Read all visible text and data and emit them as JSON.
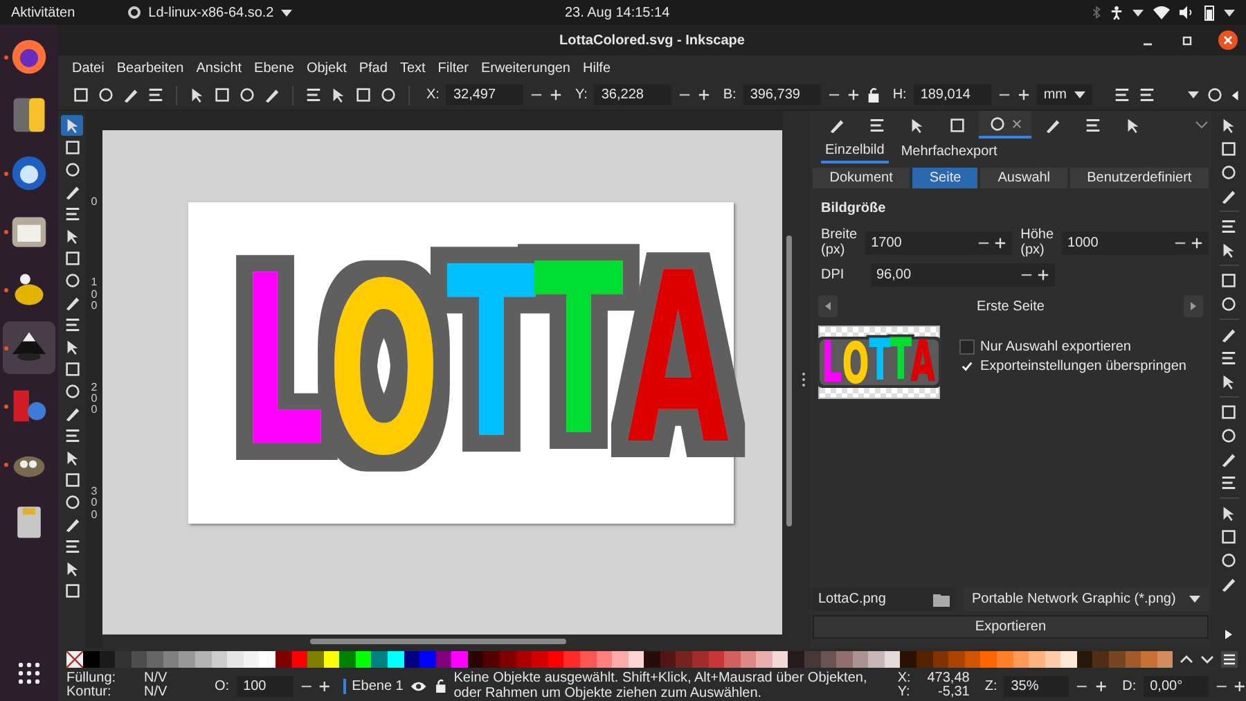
{
  "top_bar": {
    "activities": "Aktivitäten",
    "app_name": "Ld-linux-x86-64.so.2",
    "clock": "23. Aug  14:15:14"
  },
  "dock": {
    "apps": [
      {
        "running": true,
        "selected": false
      },
      {
        "running": false,
        "selected": false
      },
      {
        "running": true,
        "selected": false
      },
      {
        "running": true,
        "selected": false
      },
      {
        "running": true,
        "selected": false
      },
      {
        "running": true,
        "selected": true
      },
      {
        "running": true,
        "selected": false
      },
      {
        "running": true,
        "selected": false
      },
      {
        "running": false,
        "selected": false
      }
    ]
  },
  "window": {
    "title": "LottaColored.svg - Inkscape"
  },
  "menu": [
    "Datei",
    "Bearbeiten",
    "Ansicht",
    "Ebene",
    "Objekt",
    "Pfad",
    "Text",
    "Filter",
    "Erweiterungen",
    "Hilfe"
  ],
  "toolbar": {
    "fields": [
      {
        "label": "X:",
        "value": "32,497"
      },
      {
        "label": "Y:",
        "value": "36,228"
      },
      {
        "label": "B:",
        "value": "396,739"
      },
      {
        "label": "H:",
        "value": "189,014"
      }
    ],
    "unit": "mm"
  },
  "tools": [
    {
      "selected": true
    },
    {
      "selected": false
    },
    {
      "selected": false
    },
    {
      "selected": false
    },
    {
      "selected": false
    },
    {
      "selected": false
    },
    {
      "selected": false
    },
    {
      "selected": false
    },
    {
      "selected": false
    },
    {
      "selected": false
    },
    {
      "selected": false
    },
    {
      "selected": false
    },
    {
      "selected": false
    },
    {
      "selected": false
    },
    {
      "selected": false
    },
    {
      "selected": false
    },
    {
      "selected": false
    },
    {
      "selected": false
    },
    {
      "selected": false
    },
    {
      "selected": false
    },
    {
      "selected": false
    },
    {
      "selected": false
    }
  ],
  "ruler": {
    "labels": [
      "0",
      "100",
      "200",
      "300"
    ]
  },
  "canvas": {
    "letters": [
      {
        "text": "L",
        "color": "#ff00ff"
      },
      {
        "text": "O",
        "color": "#ffcc00"
      },
      {
        "text": "T",
        "color": "#00bfff"
      },
      {
        "text": "T",
        "color": "#00dd33"
      },
      {
        "text": "A",
        "color": "#dd0000"
      }
    ]
  },
  "export_panel": {
    "dock_tabs": [
      {
        "selected": false
      },
      {
        "selected": false
      },
      {
        "selected": false
      },
      {
        "selected": false
      },
      {
        "selected": true
      },
      {
        "selected": false
      },
      {
        "selected": false
      },
      {
        "selected": false
      }
    ],
    "tabs": [
      {
        "label": "Einzelbild",
        "selected": true
      },
      {
        "label": "Mehrfachexport",
        "selected": false
      }
    ],
    "areas": [
      {
        "label": "Dokument",
        "selected": false
      },
      {
        "label": "Seite",
        "selected": true
      },
      {
        "label": "Auswahl",
        "selected": false
      },
      {
        "label": "Benutzerdefiniert",
        "selected": false
      }
    ],
    "section_title": "Bildgröße",
    "width": {
      "label": "Breite (px)",
      "value": "1700"
    },
    "height": {
      "label": "Höhe (px)",
      "value": "1000"
    },
    "dpi": {
      "label": "DPI",
      "value": "96,00"
    },
    "page_nav": "Erste Seite",
    "preview": {
      "letters": [
        {
          "text": "L",
          "color": "#ff00ff"
        },
        {
          "text": "O",
          "color": "#ffcc00"
        },
        {
          "text": "T",
          "color": "#00bfff"
        },
        {
          "text": "T",
          "color": "#00dd33"
        },
        {
          "text": "A",
          "color": "#dd0000"
        }
      ]
    },
    "options": [
      {
        "label": "Nur Auswahl exportieren",
        "checked": false
      },
      {
        "label": "Exporteinstellungen überspringen",
        "checked": true
      }
    ],
    "filename": "LottaC.png",
    "format": "Portable Network Graphic (*.png)",
    "export_button": "Exportieren"
  },
  "palette": [
    {
      "color": "#000000"
    },
    {
      "color": "#1a1a1a"
    },
    {
      "color": "#333333"
    },
    {
      "color": "#4d4d4d"
    },
    {
      "color": "#666666"
    },
    {
      "color": "#808080"
    },
    {
      "color": "#999999"
    },
    {
      "color": "#b3b3b3"
    },
    {
      "color": "#cccccc"
    },
    {
      "color": "#e6e6e6"
    },
    {
      "color": "#f2f2f2"
    },
    {
      "color": "#ffffff"
    },
    {
      "color": "#800000"
    },
    {
      "color": "#ff0000"
    },
    {
      "color": "#808000"
    },
    {
      "color": "#ffff00"
    },
    {
      "color": "#008000"
    },
    {
      "color": "#00ff00"
    },
    {
      "color": "#008080"
    },
    {
      "color": "#00ffff"
    },
    {
      "color": "#000080"
    },
    {
      "color": "#0000ff"
    },
    {
      "color": "#800080"
    },
    {
      "color": "#ff00ff"
    },
    {
      "color": "#2b0000"
    },
    {
      "color": "#550000"
    },
    {
      "color": "#800001"
    },
    {
      "color": "#aa0000"
    },
    {
      "color": "#d40000"
    },
    {
      "color": "#ff0001"
    },
    {
      "color": "#ff2a2a"
    },
    {
      "color": "#ff5555"
    },
    {
      "color": "#ff8080"
    },
    {
      "color": "#ffaaaa"
    },
    {
      "color": "#ffd5d5"
    },
    {
      "color": "#280b0b"
    },
    {
      "color": "#501616"
    },
    {
      "color": "#782121"
    },
    {
      "color": "#a02c2c"
    },
    {
      "color": "#c83737"
    },
    {
      "color": "#d35f5f"
    },
    {
      "color": "#de8787"
    },
    {
      "color": "#e9afaf"
    },
    {
      "color": "#f4d7d7"
    },
    {
      "color": "#241c1c"
    },
    {
      "color": "#483737"
    },
    {
      "color": "#6c5353"
    },
    {
      "color": "#916f6f"
    },
    {
      "color": "#ac9393"
    },
    {
      "color": "#c8b7b7"
    },
    {
      "color": "#e3dbdb"
    },
    {
      "color": "#2b1100"
    },
    {
      "color": "#552200"
    },
    {
      "color": "#803300"
    },
    {
      "color": "#aa4400"
    },
    {
      "color": "#d45500"
    },
    {
      "color": "#ff6600"
    },
    {
      "color": "#ff7f2a"
    },
    {
      "color": "#ff9955"
    },
    {
      "color": "#ffb380"
    },
    {
      "color": "#ffccaa"
    },
    {
      "color": "#ffe6d5"
    },
    {
      "color": "#28170b"
    },
    {
      "color": "#502d16"
    },
    {
      "color": "#784421"
    },
    {
      "color": "#a05a2c"
    },
    {
      "color": "#c87137"
    },
    {
      "color": "#d38d5f"
    }
  ],
  "status_bar": {
    "fill_label": "Füllung:",
    "fill_value": "N/V",
    "stroke_label": "Kontur:",
    "stroke_value": "N/V",
    "opacity_label": "O:",
    "opacity": "100",
    "layer": "Ebene 1",
    "message": "Keine Objekte ausgewählt. Shift+Klick, Alt+Mausrad über Objekten, oder Rahmen um Objekte ziehen zum Auswählen.",
    "cursor": [
      {
        "label": "X:",
        "value": "473,48"
      },
      {
        "label": "Y:",
        "value": "-5,31"
      }
    ],
    "zoom_label": "Z:",
    "zoom": "35%",
    "rotation_label": "D:",
    "rotation": "0,00°"
  }
}
